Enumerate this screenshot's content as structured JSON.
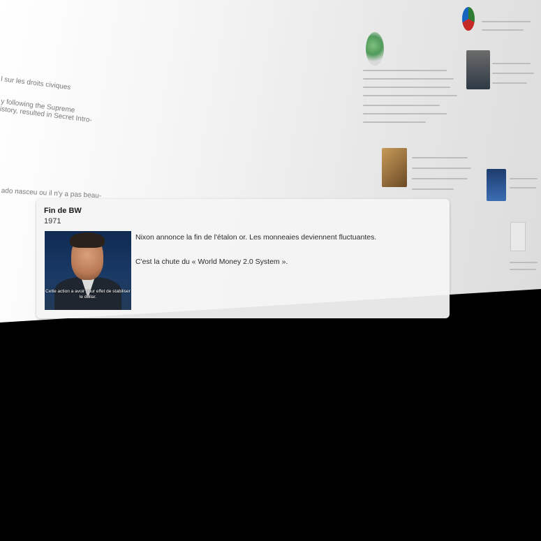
{
  "background": {
    "snippets": [
      "l sur les droits civiques",
      "y following the Supreme",
      "istory, resulted in Secret Intro-",
      "ado nasceu ou il n'y a pas beau-"
    ]
  },
  "card": {
    "title": "Fin de BW",
    "year": "1971",
    "image_caption": "Cette action a avoir pour effet de stabiliser le dollar.",
    "paragraphs": [
      "Nixon annonce la fin de l'étalon or. Les monneaies deviennent fluctuantes.",
      "C'est la chute du « World Money 2.0 System »."
    ]
  },
  "colors": {
    "card_bg": "#f4f4f4",
    "image_bg": "#1a3a66",
    "floor": "#000000"
  }
}
